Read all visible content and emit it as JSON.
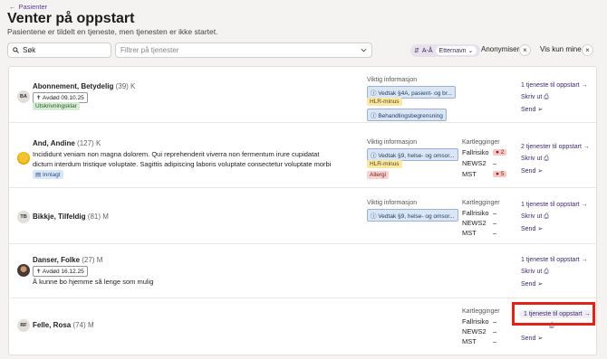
{
  "header": {
    "back_label": "Pasienter",
    "title": "Venter på oppstart",
    "subtitle": "Pasientene er tildelt en tjeneste, men tjenesten er ikke startet."
  },
  "toolbar": {
    "search_placeholder": "Søk",
    "filter_placeholder": "Filtrer på tjenester",
    "sort_order": "A-Å",
    "sort_field": "Etternavn",
    "anonymise_label": "Anonymiser",
    "only_mine_label": "Vis kun mine",
    "close_icon": "×"
  },
  "colors": {
    "accent": "#3b2a6e",
    "highlight": "#e32119"
  },
  "patients": [
    {
      "initials": "BA",
      "name": "Abonnement, Betydelig",
      "age": "(39)",
      "gender": "K",
      "deceased": "Avdød 09.10.25",
      "status_tag": "Utskrivningsklar",
      "info_header": "Viktig informasjon",
      "info": [
        "Vedtak §4A, pasient- og br...",
        "HLR-minus",
        "Behandlingsbegrensning"
      ],
      "action": "1 tjeneste til oppstart",
      "print": "Skriv ut",
      "send": "Send"
    },
    {
      "initials": "",
      "name": "And, Andine",
      "age": "(127)",
      "gender": "K",
      "note": "Incididunt veniam non magna dolorem. Qui reprehenderit viverra non fermentum irure cupidatat dictum interdum tristique voluptate. Sagittis adipiscing laboris voluptate consectetur voluptate morbi fauc...",
      "status_tag": "Innlagt",
      "info_header": "Viktig informasjon",
      "info": [
        "Vedtak §9, helse- og omsor...",
        "HLR-minus",
        "Allergi"
      ],
      "k_header": "Kartlegginger",
      "k_items": [
        {
          "label": "Fallrisiko",
          "value": "2"
        },
        {
          "label": "NEWS2",
          "value": "–"
        },
        {
          "label": "MST",
          "value": "5"
        }
      ],
      "action": "2 tjenester til oppstart",
      "print": "Skriv ut",
      "send": "Send"
    },
    {
      "initials": "TB",
      "name": "Bikkje, Tilfeldig",
      "age": "(81)",
      "gender": "M",
      "info_header": "Viktig informasjon",
      "info": [
        "Vedtak §9, helse- og omsor..."
      ],
      "k_header": "Kartlegginger",
      "k_items": [
        {
          "label": "Fallrisiko",
          "value": "–"
        },
        {
          "label": "NEWS2",
          "value": "–"
        },
        {
          "label": "MST",
          "value": "–"
        }
      ],
      "action": "1 tjeneste til oppstart",
      "print": "Skriv ut",
      "send": "Send"
    },
    {
      "initials": "",
      "name": "Danser, Folke",
      "age": "(27)",
      "gender": "M",
      "deceased": "Avdød 16.12.25",
      "note": "Å kunne bo hjemme så lenge som mulig",
      "action": "1 tjeneste til oppstart",
      "print": "Skriv ut",
      "send": "Send"
    },
    {
      "initials": "RF",
      "name": "Felle, Rosa",
      "age": "(74)",
      "gender": "M",
      "k_header": "Kartlegginger",
      "k_items": [
        {
          "label": "Fallrisiko",
          "value": "–"
        },
        {
          "label": "NEWS2",
          "value": "–"
        },
        {
          "label": "MST",
          "value": "–"
        }
      ],
      "action": "1 tjeneste til oppstart",
      "print": "Skriv ut",
      "send": "Send"
    }
  ]
}
